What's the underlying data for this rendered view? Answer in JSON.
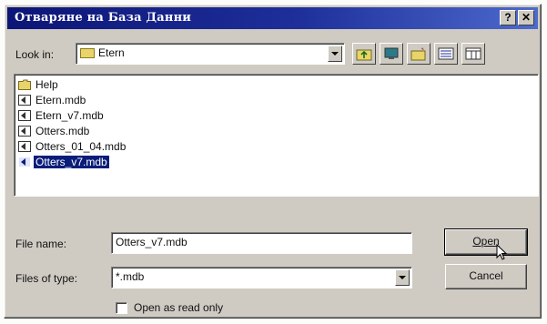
{
  "window": {
    "title": "Отваряне на База Данни",
    "help_glyph": "?",
    "close_glyph": "✕"
  },
  "look_in": {
    "label": "Look in:",
    "value": "Etern"
  },
  "toolbar": {
    "icons": [
      "up-folder-icon",
      "desktop-icon",
      "new-folder-icon",
      "list-view-icon",
      "details-view-icon"
    ]
  },
  "files": [
    {
      "name": "Help",
      "type": "folder",
      "selected": false
    },
    {
      "name": "Etern.mdb",
      "type": "mdb",
      "selected": false
    },
    {
      "name": "Etern_v7.mdb",
      "type": "mdb",
      "selected": false
    },
    {
      "name": "Otters.mdb",
      "type": "mdb",
      "selected": false
    },
    {
      "name": "Otters_01_04.mdb",
      "type": "mdb",
      "selected": false
    },
    {
      "name": "Otters_v7.mdb",
      "type": "mdb",
      "selected": true
    }
  ],
  "file_name": {
    "label": "File name:",
    "value": "Otters_v7.mdb"
  },
  "file_type": {
    "label": "Files of type:",
    "value": "*.mdb"
  },
  "read_only": {
    "label": "Open as read only",
    "checked": false
  },
  "buttons": {
    "open": "Open",
    "cancel": "Cancel"
  },
  "colors": {
    "title_gradient_start": "#0c1677",
    "title_gradient_end": "#4d6acd",
    "selection": "#0a1d7a",
    "face": "#cfcbc3"
  }
}
